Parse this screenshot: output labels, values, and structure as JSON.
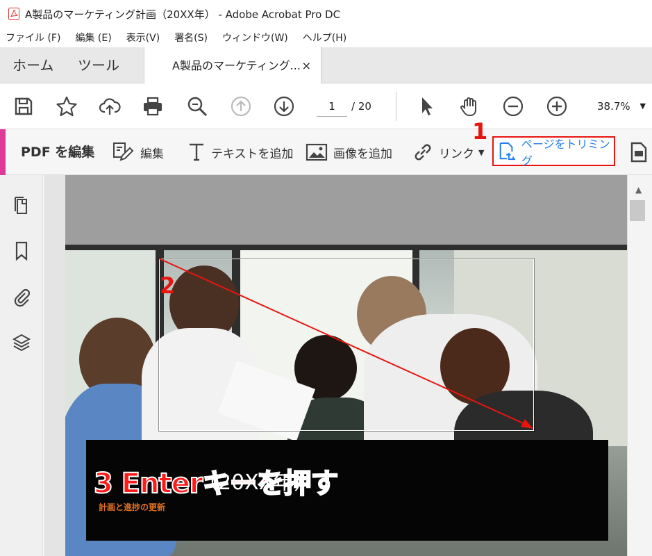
{
  "window": {
    "title": "A製品のマーケティング計画（20XX年） - Adobe Acrobat Pro DC"
  },
  "menu": {
    "items": [
      "ファイル (F)",
      "編集 (E)",
      "表示(V)",
      "署名(S)",
      "ウィンドウ(W)",
      "ヘルプ(H)"
    ]
  },
  "tabs": {
    "home": "ホーム",
    "tools": "ツール",
    "document": "A製品のマーケティング...",
    "close": "×"
  },
  "toolbar": {
    "icons": [
      "save-icon",
      "star-icon",
      "upload-icon",
      "print-icon",
      "search-icon",
      "page-up-icon",
      "page-down-icon",
      "pointer-icon",
      "hand-icon",
      "zoom-out-icon",
      "zoom-in-icon"
    ],
    "page_current": "1",
    "page_total": "/ 20",
    "zoom": "38.7%"
  },
  "edit_bar": {
    "title": "PDF を編集",
    "edit": "編集",
    "add_text": "テキストを追加",
    "add_image": "画像を追加",
    "link": "リンク",
    "crop": "ページをトリミング"
  },
  "document": {
    "banner_title": "（20XX年）",
    "banner_subtitle": "計画と進捗の更新"
  },
  "annotations": {
    "step1": "1",
    "step2": "2",
    "step3": "3 Enterキーを押す",
    "color": "#e8150f"
  }
}
